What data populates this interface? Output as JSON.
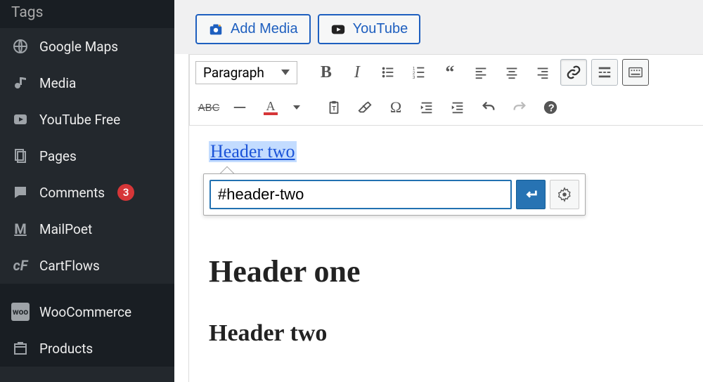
{
  "sidebar": {
    "section_title": "Tags",
    "items": [
      {
        "label": "Google Maps",
        "icon": "globe"
      },
      {
        "label": "Media",
        "icon": "media"
      },
      {
        "label": "YouTube Free",
        "icon": "youtube-play"
      },
      {
        "label": "Pages",
        "icon": "pages"
      },
      {
        "label": "Comments",
        "icon": "comment",
        "badge": "3"
      },
      {
        "label": "MailPoet",
        "icon": "mailpoet"
      },
      {
        "label": "CartFlows",
        "icon": "cartflows"
      },
      {
        "label": "WooCommerce",
        "icon": "woo"
      },
      {
        "label": "Products",
        "icon": "products"
      }
    ]
  },
  "media_buttons": {
    "add_media": "Add Media",
    "youtube": "YouTube"
  },
  "toolbar": {
    "format_label": "Paragraph"
  },
  "link_editor": {
    "selected_text": "Header two",
    "url_value": "#header-two"
  },
  "content": {
    "h1": "Header one",
    "h2": "Header two"
  }
}
